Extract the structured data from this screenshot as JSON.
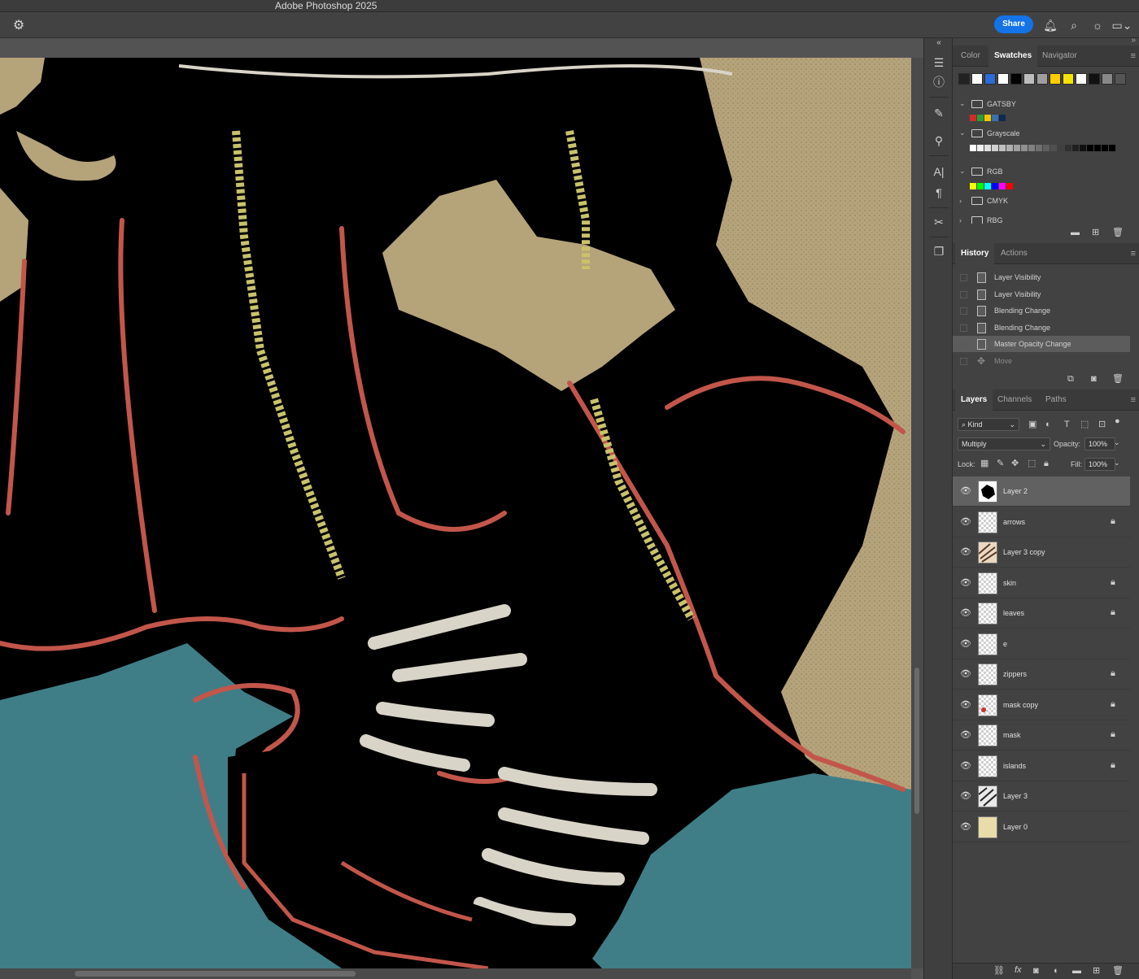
{
  "window": {
    "title": "Adobe Photoshop 2025"
  },
  "optionsbar": {
    "share_label": "Share"
  },
  "panels": {
    "color_tabs": [
      "Color",
      "Swatches",
      "Navigator"
    ],
    "swatch_groups": [
      "GATSBY",
      "Grayscale",
      "RGB",
      "CMYK",
      "RBG"
    ],
    "history_tabs": [
      "History",
      "Actions"
    ],
    "history_items": [
      "Layer Visibility",
      "Layer Visibility",
      "Blending Change",
      "Blending Change",
      "Master Opacity Change",
      "Move"
    ],
    "layers_tabs": [
      "Layers",
      "Channels",
      "Paths"
    ],
    "kind_label": "Kind",
    "blend_mode": "Multiply",
    "opacity_label": "Opacity:",
    "opacity_value": "100%",
    "lock_label": "Lock:",
    "fill_label": "Fill:",
    "fill_value": "100%",
    "layers": [
      {
        "name": "Layer 2",
        "locked": false,
        "selected": true
      },
      {
        "name": "arrows",
        "locked": true
      },
      {
        "name": "Layer 3 copy",
        "locked": false
      },
      {
        "name": "skin",
        "locked": true
      },
      {
        "name": "leaves",
        "locked": true
      },
      {
        "name": "e",
        "locked": false
      },
      {
        "name": "zippers",
        "locked": true
      },
      {
        "name": "mask copy",
        "locked": true
      },
      {
        "name": "mask",
        "locked": true
      },
      {
        "name": "islands",
        "locked": true
      },
      {
        "name": "Layer 3",
        "locked": false
      },
      {
        "name": "Layer 0",
        "locked": false
      }
    ]
  },
  "colors": {
    "accent": "#1473e6",
    "teal_ground": "#3f7e87",
    "tan_bg": "#b5a37a",
    "red_outline": "#c2564a",
    "stripe_white": "#d9d4c8",
    "zipper_yellow": "#c9c26a"
  }
}
